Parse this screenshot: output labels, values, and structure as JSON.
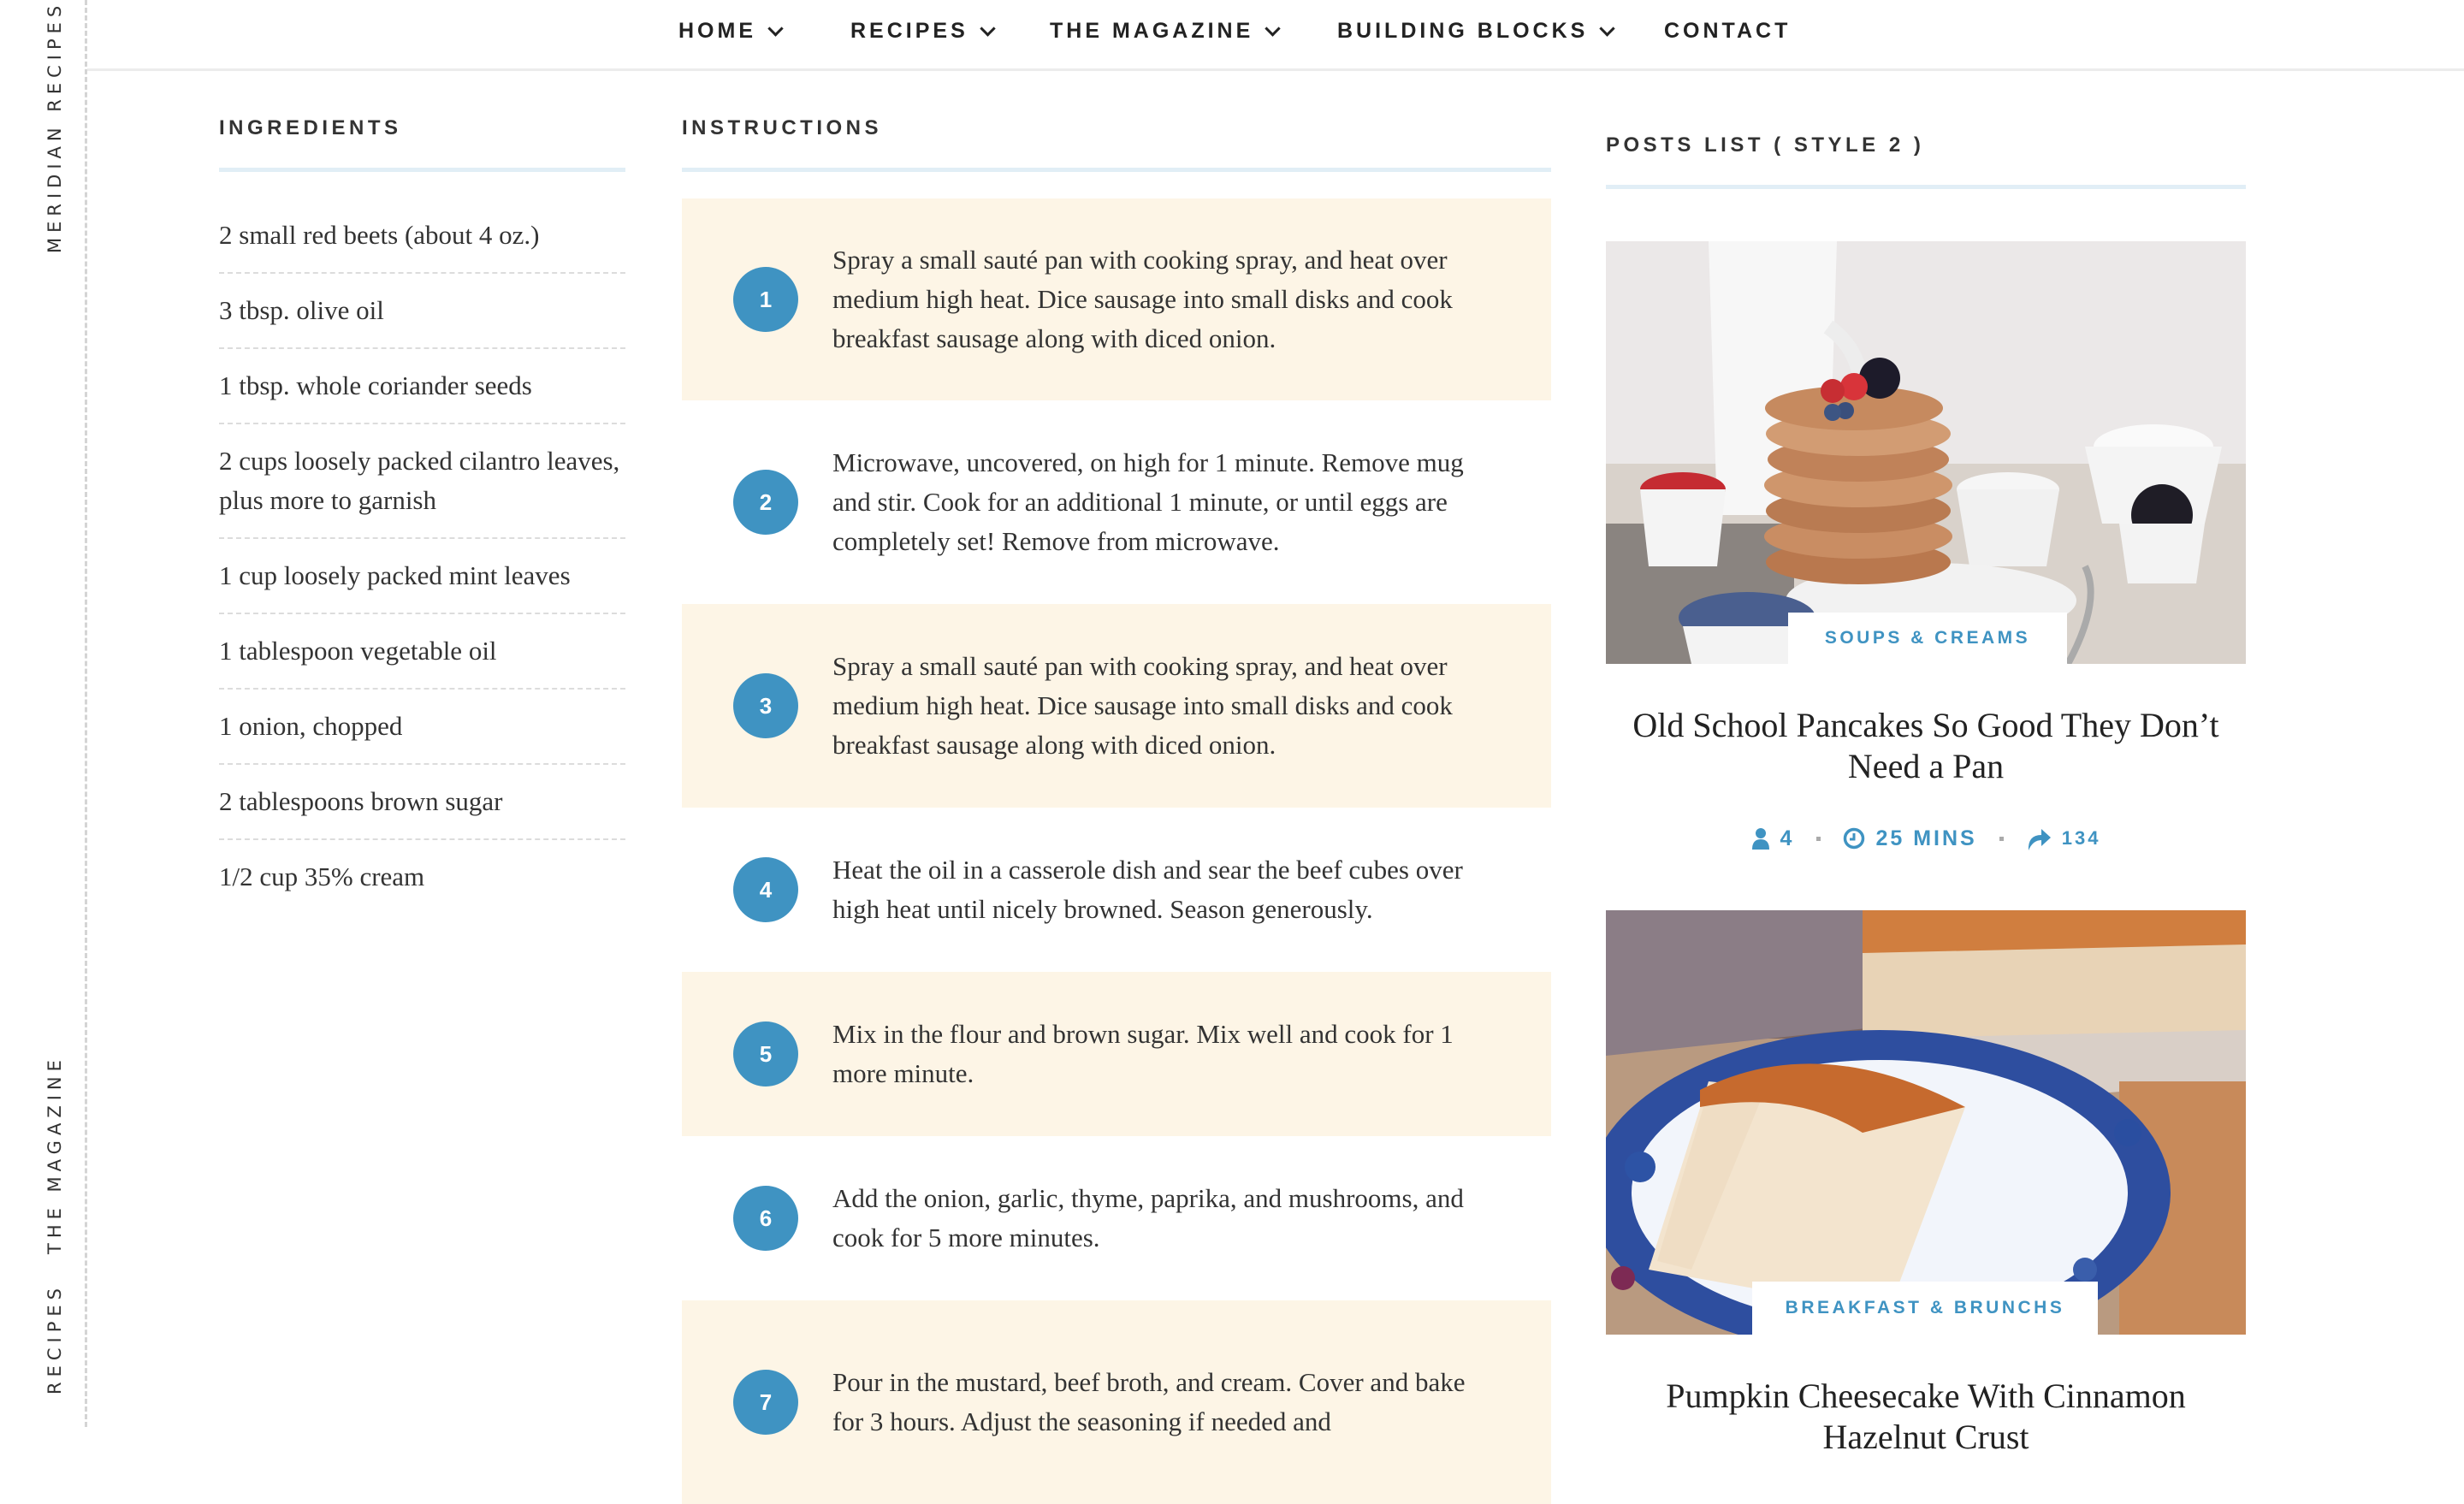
{
  "rail": {
    "site_name": "Meridian Recipes",
    "links": [
      "The Magazine",
      "Recipes"
    ]
  },
  "nav": {
    "items": [
      {
        "label": "HOME",
        "has_dropdown": true
      },
      {
        "label": "RECIPES",
        "has_dropdown": true
      },
      {
        "label": "THE MAGAZINE",
        "has_dropdown": true
      },
      {
        "label": "BUILDING BLOCKS",
        "has_dropdown": true
      },
      {
        "label": "CONTACT",
        "has_dropdown": false
      }
    ]
  },
  "ingredients": {
    "title": "Ingredients",
    "items": [
      "2 small red beets (about 4 oz.)",
      "3 tbsp. olive oil",
      "1 tbsp. whole coriander seeds",
      "2 cups loosely packed cilantro leaves, plus more to garnish",
      "1 cup loosely packed mint leaves",
      "1 tablespoon vegetable oil",
      "1 onion, chopped",
      "2 tablespoons brown sugar",
      "1/2 cup 35% cream"
    ]
  },
  "instructions": {
    "title": "Instructions",
    "steps": [
      {
        "number": "1",
        "text": "Spray a small sauté pan with cooking spray, and heat over medium high heat. Dice sausage into small disks and cook breakfast sausage along with diced onion."
      },
      {
        "number": "2",
        "text": "Microwave, uncovered, on high for 1 minute. Remove mug and stir. Cook for an additional 1 minute, or until eggs are completely set! Remove from microwave."
      },
      {
        "number": "3",
        "text": "Spray a small sauté pan with cooking spray, and heat over medium high heat. Dice sausage into small disks and cook breakfast sausage along with diced onion."
      },
      {
        "number": "4",
        "text": "Heat the oil in a casserole dish and sear the beef cubes over high heat until nicely browned. Season generously."
      },
      {
        "number": "5",
        "text": "Mix in the flour and brown sugar. Mix well and cook for 1 more minute."
      },
      {
        "number": "6",
        "text": "Add the onion, garlic, thyme, paprika, and mushrooms, and cook for 5 more minutes."
      },
      {
        "number": "7",
        "text": "Pour in the mustard, beef broth, and cream. Cover and bake for 3 hours. Adjust the seasoning if needed and"
      }
    ]
  },
  "posts": {
    "title": "Posts List ( Style 2 )",
    "items": [
      {
        "category": "SOUPS & CREAMS",
        "title": "Old School Pancakes So Good They Don’t Need a Pan",
        "image": "pancake-stack-with-berries",
        "servings": "4",
        "time": "25 MINS",
        "shares": "134"
      },
      {
        "category": "BREAKFAST & BRUNCHS",
        "title": "Pumpkin Cheesecake With Cinnamon Hazelnut Crust",
        "image": "cheesecake-slice-on-blue-plate"
      }
    ]
  },
  "colors": {
    "accent": "#3f93c2",
    "step_highlight": "#fdf5e6",
    "divider_bar": "#e1eef6",
    "text": "#333333"
  }
}
